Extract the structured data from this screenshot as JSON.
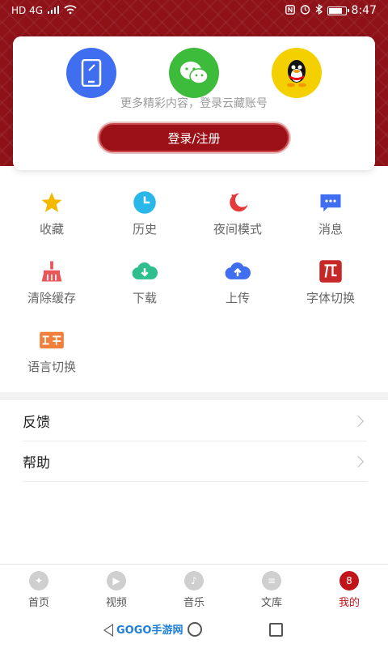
{
  "status_bar": {
    "network": "HD 4G",
    "time": "8:47"
  },
  "login_card": {
    "tagline": "更多精彩内容，登录云藏账号",
    "login_label": "登录/注册"
  },
  "features": [
    {
      "label": "收藏",
      "icon": "star-icon"
    },
    {
      "label": "历史",
      "icon": "clock-icon"
    },
    {
      "label": "夜间模式",
      "icon": "moon-icon"
    },
    {
      "label": "消息",
      "icon": "message-icon"
    },
    {
      "label": "清除缓存",
      "icon": "broom-icon"
    },
    {
      "label": "下载",
      "icon": "cloud-download-icon"
    },
    {
      "label": "上传",
      "icon": "cloud-upload-icon"
    },
    {
      "label": "字体切换",
      "icon": "font-icon"
    },
    {
      "label": "语言切换",
      "icon": "language-icon"
    }
  ],
  "rows": {
    "feedback": "反馈",
    "help": "帮助"
  },
  "tabs": {
    "home": "首页",
    "video": "视频",
    "music": "音乐",
    "library": "文库",
    "mine": "我的"
  },
  "watermark": "GOGO手游网",
  "colors": {
    "header": "#8e1218",
    "accent": "#c0141a",
    "phone": "#3f6ff0",
    "wechat": "#3dbb3a",
    "qq": "#f5d000"
  }
}
